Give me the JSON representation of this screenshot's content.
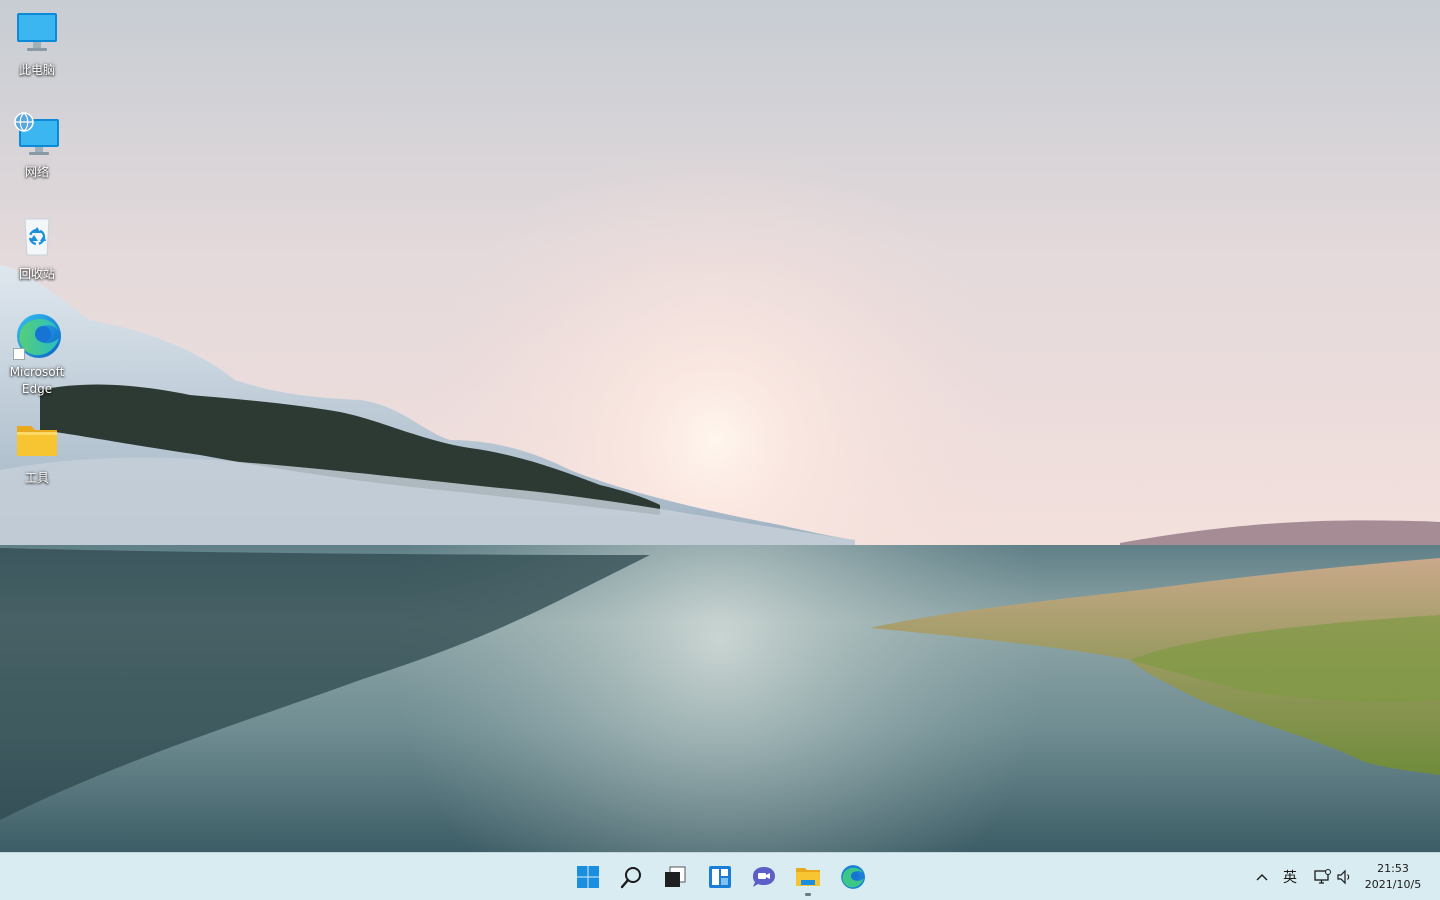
{
  "desktop": {
    "icons": [
      {
        "label": "此电脑",
        "icon": "monitor-icon"
      },
      {
        "label": "网络",
        "icon": "network-icon"
      },
      {
        "label": "回收站",
        "icon": "recycle-bin-icon"
      },
      {
        "label": "Microsoft\nEdge",
        "icon": "edge-icon"
      },
      {
        "label": "工具",
        "icon": "folder-icon"
      }
    ]
  },
  "taskbar": {
    "pinned": [
      {
        "name": "start",
        "icon": "windows-start-icon"
      },
      {
        "name": "search",
        "icon": "search-icon"
      },
      {
        "name": "task-view",
        "icon": "task-view-icon"
      },
      {
        "name": "widgets",
        "icon": "widgets-icon"
      },
      {
        "name": "chat",
        "icon": "chat-icon"
      },
      {
        "name": "file-explorer",
        "icon": "file-explorer-icon",
        "running": true
      },
      {
        "name": "edge",
        "icon": "edge-icon"
      }
    ],
    "tray": {
      "overflow_icon": "chevron-up-icon",
      "ime_label": "英",
      "network_icon": "network-status-icon",
      "volume_icon": "volume-icon",
      "time": "21:53",
      "date": "2021/10/5"
    }
  },
  "colors": {
    "taskbar": "#d9ecf2",
    "windows_blue": "#0a7ad6",
    "folder_yellow": "#f7c531"
  }
}
